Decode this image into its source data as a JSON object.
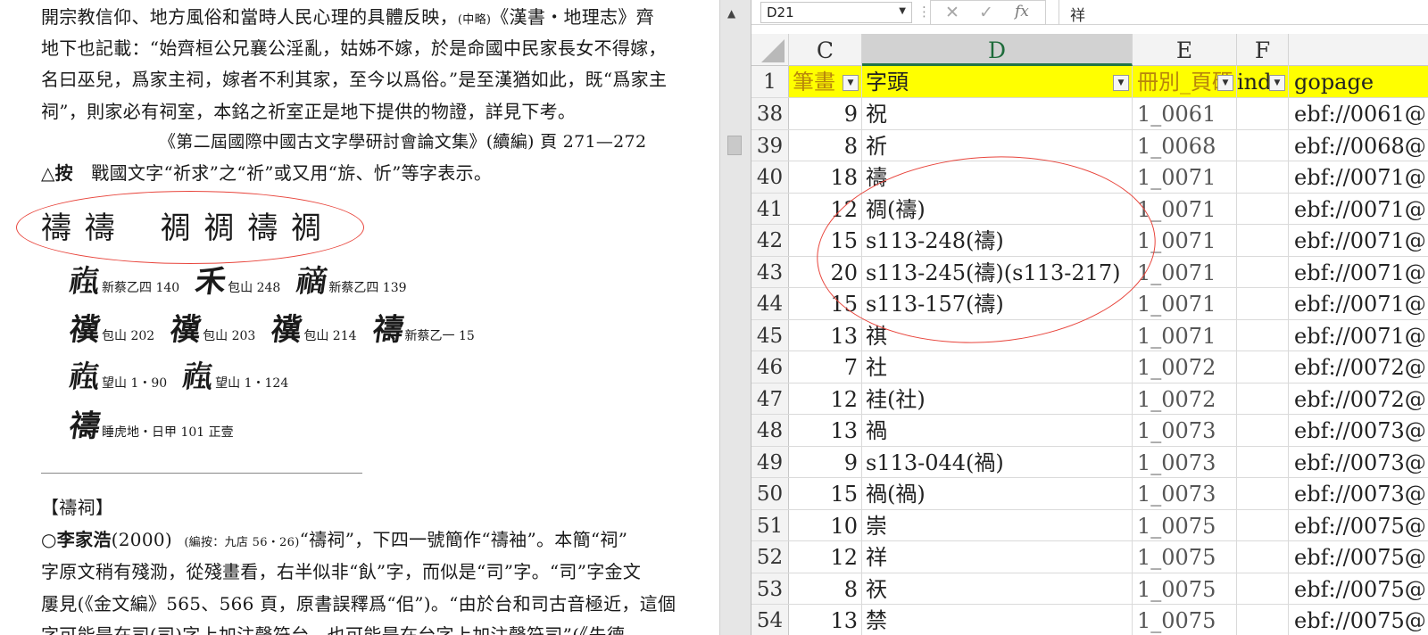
{
  "document": {
    "lines": [
      {
        "text_a": "開宗教信仰、地方風俗和當時人民心理的具體反映，",
        "small": "(中略)",
        "text_b": "《漢書・地理志》齊"
      },
      {
        "text": "地下也記載：“始齊桓公兄襄公淫亂，姑姊不嫁，於是命國中民家長女不得嫁，"
      },
      {
        "text": "名曰巫兒，爲家主祠，嫁者不利其家，至今以爲俗。”是至漢猶如此，既“爲家主"
      },
      {
        "text": "祠”，則家必有祠室，本銘之祈室正是地下提供的物證，詳見下考。"
      },
      {
        "text": "《第二屆國際中國古文字學研討會論文集》(續編) 頁 271—272"
      },
      {
        "bold": "△按",
        "text": "　戰國文字“祈求”之“祈”或又用“旂、忻”等字表示。"
      }
    ],
    "glyph_row": "禱 禱　 禂 禂 禱 禂",
    "examples": [
      [
        {
          "glyph": "𥙰",
          "src": "新蔡乙四 140"
        },
        {
          "glyph": "禾",
          "src": "包山 248"
        },
        {
          "glyph": "𥛚",
          "src": "新蔡乙四 139"
        }
      ],
      [
        {
          "glyph": "𥜥",
          "src": "包山 202"
        },
        {
          "glyph": "𥜥",
          "src": "包山 203"
        },
        {
          "glyph": "𥜥",
          "src": "包山 214"
        },
        {
          "glyph": "禱",
          "src": "新蔡乙一 15"
        }
      ],
      [
        {
          "glyph": "𥙰",
          "src": "望山 1・90"
        },
        {
          "glyph": "𥙰",
          "src": "望山 1・124"
        }
      ],
      [
        {
          "glyph": "禱",
          "src": "睡虎地・日甲 101 正壹"
        }
      ]
    ],
    "heading": "【禱祠】",
    "p1_pre": "○",
    "p1_bold": "李家浩",
    "p1_year": "(2000)",
    "p1_note": "(編按：九店 56・26)",
    "p1_rest": "“禱祠”，下四一號簡作“禱袖”。本簡“祠”",
    "p2": "字原文稍有殘泐，從殘畫看，右半似非“飤”字，而似是“司”字。“司”字金文",
    "p3": "屢見(《金文編》565、566 頁，原書誤釋爲“佀”)。“由於台和司古音極近，這個",
    "p4": "字可能是在司(司)字上加注聲符台，也可能是在台字上加注聲符司”(《先德"
  },
  "spreadsheet": {
    "name_box": "D21",
    "formula_value": "祥",
    "columns": [
      "C",
      "D",
      "E",
      "F"
    ],
    "header_row": {
      "row_num": "1",
      "c": "筆畫",
      "d": "字頭",
      "e": "冊別_頁碼",
      "f": "ind",
      "g": "gopage"
    },
    "rows": [
      {
        "n": "38",
        "c": "9",
        "d": "祝",
        "e": "1_0061",
        "g": "ebf://0061@"
      },
      {
        "n": "39",
        "c": "8",
        "d": "祈",
        "e": "1_0068",
        "g": "ebf://0068@"
      },
      {
        "n": "40",
        "c": "18",
        "d": "禱",
        "e": "1_0071",
        "g": "ebf://0071@"
      },
      {
        "n": "41",
        "c": "12",
        "d": "禂(禱)",
        "e": "1_0071",
        "g": "ebf://0071@"
      },
      {
        "n": "42",
        "c": "15",
        "d": "s113-248(禱)",
        "e": "1_0071",
        "g": "ebf://0071@"
      },
      {
        "n": "43",
        "c": "20",
        "d": "s113-245(禱)(s113-217)",
        "e": "1_0071",
        "g": "ebf://0071@"
      },
      {
        "n": "44",
        "c": "15",
        "d": "s113-157(禱)",
        "e": "1_0071",
        "g": "ebf://0071@"
      },
      {
        "n": "45",
        "c": "13",
        "d": "祺",
        "e": "1_0071",
        "g": "ebf://0071@"
      },
      {
        "n": "46",
        "c": "7",
        "d": "社",
        "e": "1_0072",
        "g": "ebf://0072@"
      },
      {
        "n": "47",
        "c": "12",
        "d": "袿(社)",
        "e": "1_0072",
        "g": "ebf://0072@"
      },
      {
        "n": "48",
        "c": "13",
        "d": "禍",
        "e": "1_0073",
        "g": "ebf://0073@"
      },
      {
        "n": "49",
        "c": "9",
        "d": "s113-044(禍)",
        "e": "1_0073",
        "g": "ebf://0073@"
      },
      {
        "n": "50",
        "c": "15",
        "d": "禍(禍)",
        "e": "1_0073",
        "g": "ebf://0073@"
      },
      {
        "n": "51",
        "c": "10",
        "d": "崇",
        "e": "1_0075",
        "g": "ebf://0075@"
      },
      {
        "n": "52",
        "c": "12",
        "d": "祥",
        "e": "1_0075",
        "g": "ebf://0075@"
      },
      {
        "n": "53",
        "c": "8",
        "d": "祆",
        "e": "1_0075",
        "g": "ebf://0075@"
      },
      {
        "n": "54",
        "c": "13",
        "d": "禁",
        "e": "1_0075",
        "g": "ebf://0075@"
      }
    ]
  },
  "colors": {
    "header_fill": "#ffff00",
    "annotation": "#e8453c",
    "selection": "#217346"
  }
}
